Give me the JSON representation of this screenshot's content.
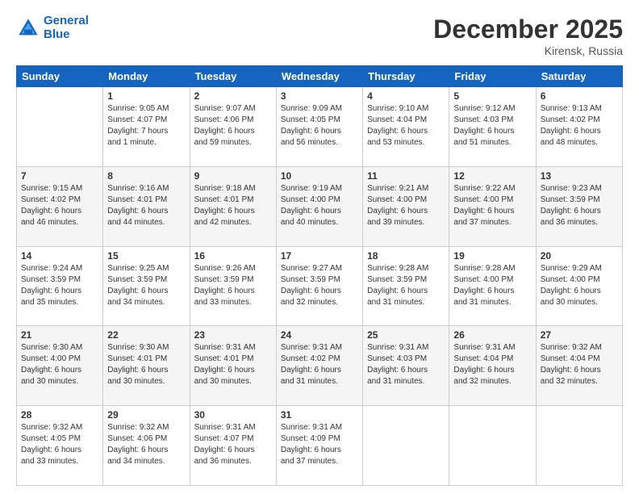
{
  "logo": {
    "line1": "General",
    "line2": "Blue"
  },
  "title": "December 2025",
  "location": "Kirensk, Russia",
  "days_header": [
    "Sunday",
    "Monday",
    "Tuesday",
    "Wednesday",
    "Thursday",
    "Friday",
    "Saturday"
  ],
  "weeks": [
    [
      {
        "num": "",
        "info": ""
      },
      {
        "num": "1",
        "info": "Sunrise: 9:05 AM\nSunset: 4:07 PM\nDaylight: 7 hours\nand 1 minute."
      },
      {
        "num": "2",
        "info": "Sunrise: 9:07 AM\nSunset: 4:06 PM\nDaylight: 6 hours\nand 59 minutes."
      },
      {
        "num": "3",
        "info": "Sunrise: 9:09 AM\nSunset: 4:05 PM\nDaylight: 6 hours\nand 56 minutes."
      },
      {
        "num": "4",
        "info": "Sunrise: 9:10 AM\nSunset: 4:04 PM\nDaylight: 6 hours\nand 53 minutes."
      },
      {
        "num": "5",
        "info": "Sunrise: 9:12 AM\nSunset: 4:03 PM\nDaylight: 6 hours\nand 51 minutes."
      },
      {
        "num": "6",
        "info": "Sunrise: 9:13 AM\nSunset: 4:02 PM\nDaylight: 6 hours\nand 48 minutes."
      }
    ],
    [
      {
        "num": "7",
        "info": "Sunrise: 9:15 AM\nSunset: 4:02 PM\nDaylight: 6 hours\nand 46 minutes."
      },
      {
        "num": "8",
        "info": "Sunrise: 9:16 AM\nSunset: 4:01 PM\nDaylight: 6 hours\nand 44 minutes."
      },
      {
        "num": "9",
        "info": "Sunrise: 9:18 AM\nSunset: 4:01 PM\nDaylight: 6 hours\nand 42 minutes."
      },
      {
        "num": "10",
        "info": "Sunrise: 9:19 AM\nSunset: 4:00 PM\nDaylight: 6 hours\nand 40 minutes."
      },
      {
        "num": "11",
        "info": "Sunrise: 9:21 AM\nSunset: 4:00 PM\nDaylight: 6 hours\nand 39 minutes."
      },
      {
        "num": "12",
        "info": "Sunrise: 9:22 AM\nSunset: 4:00 PM\nDaylight: 6 hours\nand 37 minutes."
      },
      {
        "num": "13",
        "info": "Sunrise: 9:23 AM\nSunset: 3:59 PM\nDaylight: 6 hours\nand 36 minutes."
      }
    ],
    [
      {
        "num": "14",
        "info": "Sunrise: 9:24 AM\nSunset: 3:59 PM\nDaylight: 6 hours\nand 35 minutes."
      },
      {
        "num": "15",
        "info": "Sunrise: 9:25 AM\nSunset: 3:59 PM\nDaylight: 6 hours\nand 34 minutes."
      },
      {
        "num": "16",
        "info": "Sunrise: 9:26 AM\nSunset: 3:59 PM\nDaylight: 6 hours\nand 33 minutes."
      },
      {
        "num": "17",
        "info": "Sunrise: 9:27 AM\nSunset: 3:59 PM\nDaylight: 6 hours\nand 32 minutes."
      },
      {
        "num": "18",
        "info": "Sunrise: 9:28 AM\nSunset: 3:59 PM\nDaylight: 6 hours\nand 31 minutes."
      },
      {
        "num": "19",
        "info": "Sunrise: 9:28 AM\nSunset: 4:00 PM\nDaylight: 6 hours\nand 31 minutes."
      },
      {
        "num": "20",
        "info": "Sunrise: 9:29 AM\nSunset: 4:00 PM\nDaylight: 6 hours\nand 30 minutes."
      }
    ],
    [
      {
        "num": "21",
        "info": "Sunrise: 9:30 AM\nSunset: 4:00 PM\nDaylight: 6 hours\nand 30 minutes."
      },
      {
        "num": "22",
        "info": "Sunrise: 9:30 AM\nSunset: 4:01 PM\nDaylight: 6 hours\nand 30 minutes."
      },
      {
        "num": "23",
        "info": "Sunrise: 9:31 AM\nSunset: 4:01 PM\nDaylight: 6 hours\nand 30 minutes."
      },
      {
        "num": "24",
        "info": "Sunrise: 9:31 AM\nSunset: 4:02 PM\nDaylight: 6 hours\nand 31 minutes."
      },
      {
        "num": "25",
        "info": "Sunrise: 9:31 AM\nSunset: 4:03 PM\nDaylight: 6 hours\nand 31 minutes."
      },
      {
        "num": "26",
        "info": "Sunrise: 9:31 AM\nSunset: 4:04 PM\nDaylight: 6 hours\nand 32 minutes."
      },
      {
        "num": "27",
        "info": "Sunrise: 9:32 AM\nSunset: 4:04 PM\nDaylight: 6 hours\nand 32 minutes."
      }
    ],
    [
      {
        "num": "28",
        "info": "Sunrise: 9:32 AM\nSunset: 4:05 PM\nDaylight: 6 hours\nand 33 minutes."
      },
      {
        "num": "29",
        "info": "Sunrise: 9:32 AM\nSunset: 4:06 PM\nDaylight: 6 hours\nand 34 minutes."
      },
      {
        "num": "30",
        "info": "Sunrise: 9:31 AM\nSunset: 4:07 PM\nDaylight: 6 hours\nand 36 minutes."
      },
      {
        "num": "31",
        "info": "Sunrise: 9:31 AM\nSunset: 4:09 PM\nDaylight: 6 hours\nand 37 minutes."
      },
      {
        "num": "",
        "info": ""
      },
      {
        "num": "",
        "info": ""
      },
      {
        "num": "",
        "info": ""
      }
    ]
  ]
}
